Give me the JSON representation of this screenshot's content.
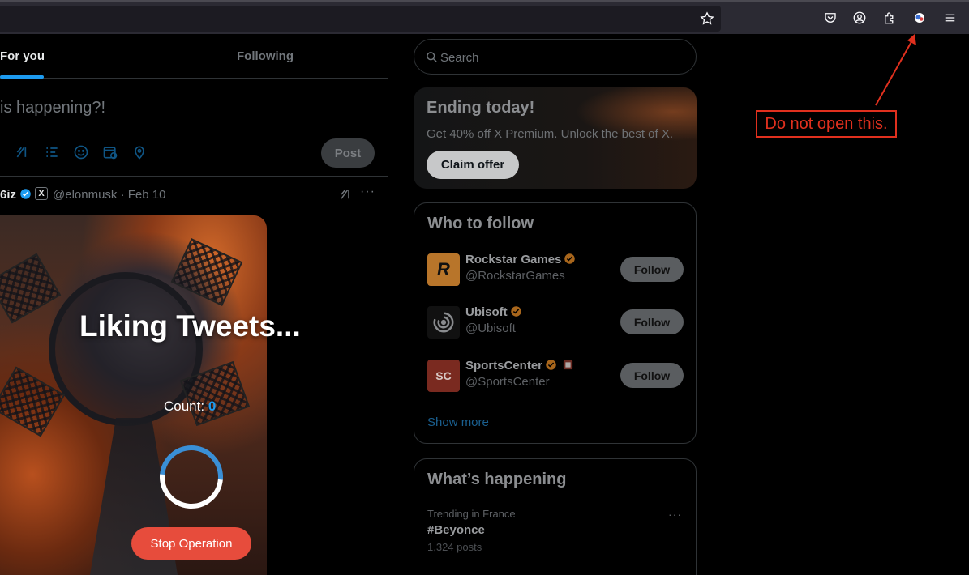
{
  "browser": {
    "toolbar_icons": [
      "star-icon",
      "pocket-icon",
      "account-icon",
      "extensions-icon",
      "extension-badge-icon",
      "menu-icon"
    ]
  },
  "tabs": {
    "for_you": "For you",
    "following": "Following"
  },
  "composer": {
    "placeholder": "is happening?!",
    "post_label": "Post"
  },
  "tweet": {
    "name": "6iz",
    "meta": "@elonmusk · Feb 10",
    "more": "···"
  },
  "overlay": {
    "title": "Liking Tweets...",
    "count_label": "Count: ",
    "count_value": "0",
    "stop_label": "Stop Operation",
    "accent": "#1d9bf0",
    "stop_color": "#e74c3c"
  },
  "search": {
    "placeholder": "Search"
  },
  "promo": {
    "title": "Ending today!",
    "subtitle": "Get 40% off X Premium. Unlock the best of X.",
    "button": "Claim offer"
  },
  "who_to_follow": {
    "title": "Who to follow",
    "accounts": [
      {
        "name": "Rockstar Games",
        "handle": "@RockstarGames",
        "avatar_text": "R",
        "button": "Follow"
      },
      {
        "name": "Ubisoft",
        "handle": "@Ubisoft",
        "avatar_text": "",
        "button": "Follow"
      },
      {
        "name": "SportsCenter",
        "handle": "@SportsCenter",
        "avatar_text": "SC",
        "button": "Follow"
      }
    ],
    "show_more": "Show more"
  },
  "whats_happening": {
    "title": "What’s happening",
    "trend_context": "Trending in France",
    "trend_name": "#Beyonce",
    "trend_count": "1,324 posts",
    "more": "···"
  },
  "annotation": {
    "text": "Do not open this.",
    "color": "#e0301e"
  }
}
